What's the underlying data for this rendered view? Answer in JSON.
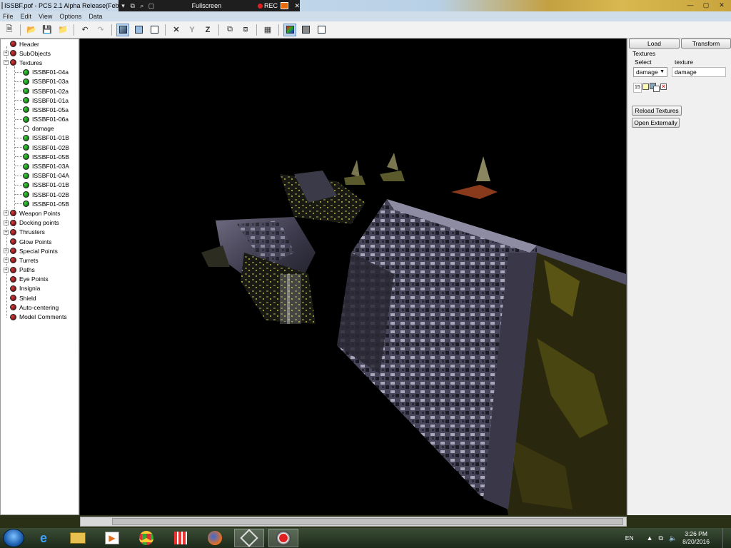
{
  "window": {
    "title": "ISSBF.pof - PCS 2.1 Alpha Release(Feb",
    "rec_bar": {
      "fullscreen_label": "Fullscreen",
      "rec_label": "REC"
    },
    "controls": [
      "minimize",
      "maximize",
      "close"
    ]
  },
  "menu": {
    "items": [
      "File",
      "Edit",
      "View",
      "Options",
      "Data"
    ]
  },
  "toolbar": {
    "buttons": [
      "new",
      "open",
      "save",
      "open-folder",
      "undo",
      "redo",
      "view-solid",
      "view-wire-solid",
      "view-wire",
      "delete-x",
      "merge-y",
      "align-z",
      "camera-a",
      "camera-b",
      "grid",
      "textured",
      "shaded",
      "outline"
    ]
  },
  "tree": {
    "nodes": [
      {
        "label": "Header",
        "status": "red"
      },
      {
        "label": "SubObjects",
        "status": "red"
      },
      {
        "label": "Textures",
        "status": "red",
        "expanded": true
      },
      {
        "label": "Weapon Points",
        "status": "red"
      },
      {
        "label": "Docking points",
        "status": "red"
      },
      {
        "label": "Thrusters",
        "status": "red"
      },
      {
        "label": "Glow Points",
        "status": "red"
      },
      {
        "label": "Special Points",
        "status": "red"
      },
      {
        "label": "Turrets",
        "status": "red"
      },
      {
        "label": "Paths",
        "status": "red"
      },
      {
        "label": "Eye Points",
        "status": "red"
      },
      {
        "label": "Insignia",
        "status": "red"
      },
      {
        "label": "Shield",
        "status": "red"
      },
      {
        "label": "Auto-centering",
        "status": "red"
      },
      {
        "label": "Model Comments",
        "status": "red"
      }
    ],
    "textures": [
      "ISSBF01-04a",
      "ISSBF01-03a",
      "ISSBF01-02a",
      "ISSBF01-01a",
      "ISSBF01-05a",
      "ISSBF01-06a",
      "damage",
      "ISSBF01-01B",
      "ISSBF01-02B",
      "ISSBF01-05B",
      "ISSBF01-03A",
      "ISSBF01-04A",
      "ISSBF01-01B",
      "ISSBF01-02B",
      "ISSBF01-05B"
    ],
    "selected_texture": "damage"
  },
  "panel": {
    "tabs": [
      "Load",
      "Transform"
    ],
    "group_label": "Textures",
    "select_label": "Select",
    "texture_label": "texture",
    "select_value": "damage",
    "texture_value": "damage",
    "index_value": "15",
    "reload_button": "Reload Textures",
    "open_button": "Open Externally"
  },
  "taskbar": {
    "apps": [
      "ie",
      "explorer",
      "media",
      "chrome",
      "metro-apps",
      "firefox",
      "pcs",
      "obs"
    ],
    "lang": "EN",
    "time": "3:26 PM",
    "date": "8/20/2016"
  }
}
